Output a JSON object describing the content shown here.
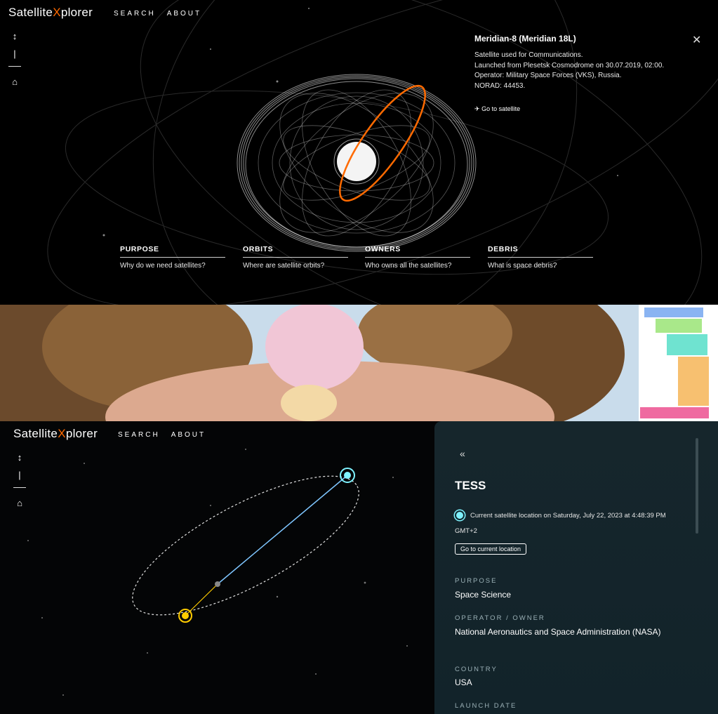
{
  "top": {
    "logo_part1": "Satellite",
    "logo_x": "X",
    "logo_part2": "plorer",
    "nav": [
      "SEARCH",
      "ABOUT"
    ],
    "info": {
      "title": "Meridian-8 (Meridian 18L)",
      "lines": [
        "Satellite used for Communications.",
        "Launched from Plesetsk Cosmodrome on 30.07.2019, 02:00.",
        "Operator: Military Space Forces (VKS), Russia.",
        "NORAD: 44453."
      ],
      "goto": "Go to satellite"
    },
    "cards": [
      {
        "heading": "PURPOSE",
        "sub": "Why do we need satellites?"
      },
      {
        "heading": "ORBITS",
        "sub": "Where are satellite orbits?"
      },
      {
        "heading": "OWNERS",
        "sub": "Who owns all the satellites?"
      },
      {
        "heading": "DEBRIS",
        "sub": "What is space debris?"
      }
    ],
    "orbit_highlight_color": "#ff6a00"
  },
  "bottom": {
    "logo_part1": "Satellite",
    "logo_x": "X",
    "logo_part2": "plorer",
    "nav": [
      "SEARCH",
      "ABOUT"
    ],
    "side": {
      "name": "TESS",
      "location_text": "Current satellite location on Saturday, July 22, 2023 at 4:48:39 PM GMT+2",
      "button": "Go to current location",
      "fields": [
        {
          "label": "PURPOSE",
          "value": "Space Science"
        },
        {
          "label": "OPERATOR / OWNER",
          "value": "National Aeronautics and Space Administration (NASA)"
        },
        {
          "label": "COUNTRY",
          "value": "USA"
        },
        {
          "label": "LAUNCH DATE",
          "value": ""
        }
      ]
    },
    "colors": {
      "satellite": "#7ff3ff",
      "sun": "#ffcc00",
      "panel": "#14252b"
    }
  }
}
